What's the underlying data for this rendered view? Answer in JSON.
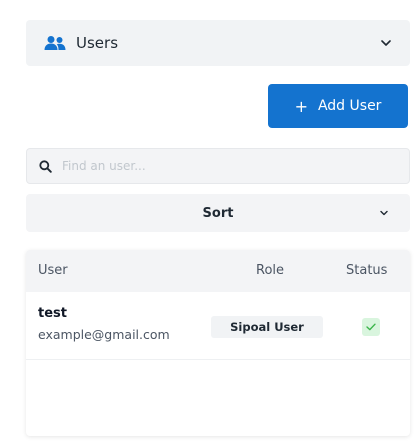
{
  "section_selector": {
    "label": "Users",
    "icon": "users-icon"
  },
  "add_user_button": {
    "label": "Add User",
    "icon": "plus-icon"
  },
  "search": {
    "placeholder": "Find an user...",
    "value": ""
  },
  "sort": {
    "label": "Sort"
  },
  "table": {
    "columns": [
      "User",
      "Role",
      "Status"
    ],
    "rows": [
      {
        "name": "test",
        "email": "example@gmail.com",
        "role": "Sipoal User",
        "status": "active-check-icon"
      }
    ]
  },
  "colors": {
    "accent": "#1473cf",
    "status_active_bg": "#d9f5de",
    "status_active_fg": "#3bb54a"
  }
}
